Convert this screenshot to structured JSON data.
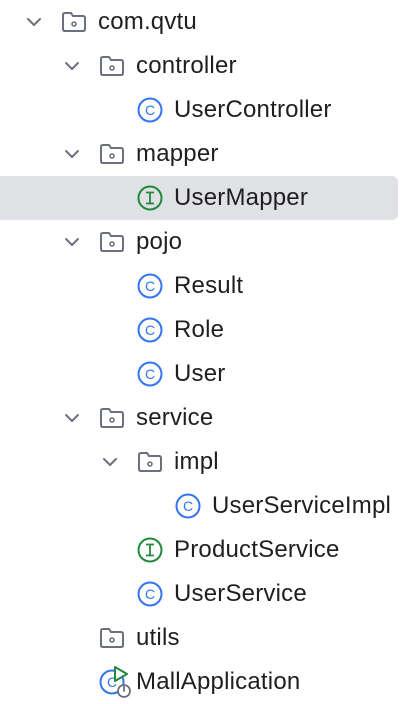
{
  "tree": {
    "nodes": [
      {
        "label": "com.qvtu",
        "kind": "package",
        "expanded": true
      },
      {
        "label": "controller",
        "kind": "package",
        "expanded": true
      },
      {
        "label": "UserController",
        "kind": "class"
      },
      {
        "label": "mapper",
        "kind": "package",
        "expanded": true
      },
      {
        "label": "UserMapper",
        "kind": "interface",
        "selected": true
      },
      {
        "label": "pojo",
        "kind": "package",
        "expanded": true
      },
      {
        "label": "Result",
        "kind": "class"
      },
      {
        "label": "Role",
        "kind": "class"
      },
      {
        "label": "User",
        "kind": "class"
      },
      {
        "label": "service",
        "kind": "package",
        "expanded": true
      },
      {
        "label": "impl",
        "kind": "package",
        "expanded": true
      },
      {
        "label": "UserServiceImpl",
        "kind": "class"
      },
      {
        "label": "ProductService",
        "kind": "interface"
      },
      {
        "label": "UserService",
        "kind": "class"
      },
      {
        "label": "utils",
        "kind": "package",
        "expanded": false
      },
      {
        "label": "MallApplication",
        "kind": "spring-boot-application"
      }
    ]
  },
  "colors": {
    "selection": "#dfe1e5",
    "class_icon": "#3574f0",
    "interface_icon": "#208a3c",
    "folder_icon": "#6c707e",
    "run_icon": "#208a3c"
  }
}
